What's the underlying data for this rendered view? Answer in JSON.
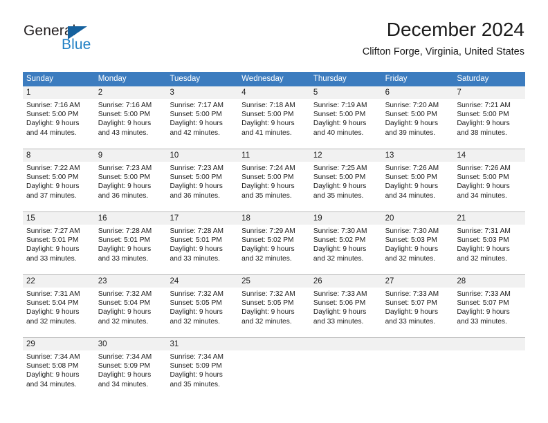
{
  "brand": {
    "name_part1": "General",
    "name_part2": "Blue",
    "triangle_icon": "triangle-icon",
    "blue": "#1f7fc4",
    "dark_blue": "#15619e"
  },
  "header": {
    "title": "December 2024",
    "subtitle": "Clifton Forge, Virginia, United States"
  },
  "calendar": {
    "header_color": "#3c7cbf",
    "daynum_band_color": "#f1f1f1",
    "weekdays": [
      "Sunday",
      "Monday",
      "Tuesday",
      "Wednesday",
      "Thursday",
      "Friday",
      "Saturday"
    ],
    "weeks": [
      {
        "days": [
          {
            "num": "1",
            "lines": [
              "Sunrise: 7:16 AM",
              "Sunset: 5:00 PM",
              "Daylight: 9 hours",
              "and 44 minutes."
            ]
          },
          {
            "num": "2",
            "lines": [
              "Sunrise: 7:16 AM",
              "Sunset: 5:00 PM",
              "Daylight: 9 hours",
              "and 43 minutes."
            ]
          },
          {
            "num": "3",
            "lines": [
              "Sunrise: 7:17 AM",
              "Sunset: 5:00 PM",
              "Daylight: 9 hours",
              "and 42 minutes."
            ]
          },
          {
            "num": "4",
            "lines": [
              "Sunrise: 7:18 AM",
              "Sunset: 5:00 PM",
              "Daylight: 9 hours",
              "and 41 minutes."
            ]
          },
          {
            "num": "5",
            "lines": [
              "Sunrise: 7:19 AM",
              "Sunset: 5:00 PM",
              "Daylight: 9 hours",
              "and 40 minutes."
            ]
          },
          {
            "num": "6",
            "lines": [
              "Sunrise: 7:20 AM",
              "Sunset: 5:00 PM",
              "Daylight: 9 hours",
              "and 39 minutes."
            ]
          },
          {
            "num": "7",
            "lines": [
              "Sunrise: 7:21 AM",
              "Sunset: 5:00 PM",
              "Daylight: 9 hours",
              "and 38 minutes."
            ]
          }
        ]
      },
      {
        "days": [
          {
            "num": "8",
            "lines": [
              "Sunrise: 7:22 AM",
              "Sunset: 5:00 PM",
              "Daylight: 9 hours",
              "and 37 minutes."
            ]
          },
          {
            "num": "9",
            "lines": [
              "Sunrise: 7:23 AM",
              "Sunset: 5:00 PM",
              "Daylight: 9 hours",
              "and 36 minutes."
            ]
          },
          {
            "num": "10",
            "lines": [
              "Sunrise: 7:23 AM",
              "Sunset: 5:00 PM",
              "Daylight: 9 hours",
              "and 36 minutes."
            ]
          },
          {
            "num": "11",
            "lines": [
              "Sunrise: 7:24 AM",
              "Sunset: 5:00 PM",
              "Daylight: 9 hours",
              "and 35 minutes."
            ]
          },
          {
            "num": "12",
            "lines": [
              "Sunrise: 7:25 AM",
              "Sunset: 5:00 PM",
              "Daylight: 9 hours",
              "and 35 minutes."
            ]
          },
          {
            "num": "13",
            "lines": [
              "Sunrise: 7:26 AM",
              "Sunset: 5:00 PM",
              "Daylight: 9 hours",
              "and 34 minutes."
            ]
          },
          {
            "num": "14",
            "lines": [
              "Sunrise: 7:26 AM",
              "Sunset: 5:00 PM",
              "Daylight: 9 hours",
              "and 34 minutes."
            ]
          }
        ]
      },
      {
        "days": [
          {
            "num": "15",
            "lines": [
              "Sunrise: 7:27 AM",
              "Sunset: 5:01 PM",
              "Daylight: 9 hours",
              "and 33 minutes."
            ]
          },
          {
            "num": "16",
            "lines": [
              "Sunrise: 7:28 AM",
              "Sunset: 5:01 PM",
              "Daylight: 9 hours",
              "and 33 minutes."
            ]
          },
          {
            "num": "17",
            "lines": [
              "Sunrise: 7:28 AM",
              "Sunset: 5:01 PM",
              "Daylight: 9 hours",
              "and 33 minutes."
            ]
          },
          {
            "num": "18",
            "lines": [
              "Sunrise: 7:29 AM",
              "Sunset: 5:02 PM",
              "Daylight: 9 hours",
              "and 32 minutes."
            ]
          },
          {
            "num": "19",
            "lines": [
              "Sunrise: 7:30 AM",
              "Sunset: 5:02 PM",
              "Daylight: 9 hours",
              "and 32 minutes."
            ]
          },
          {
            "num": "20",
            "lines": [
              "Sunrise: 7:30 AM",
              "Sunset: 5:03 PM",
              "Daylight: 9 hours",
              "and 32 minutes."
            ]
          },
          {
            "num": "21",
            "lines": [
              "Sunrise: 7:31 AM",
              "Sunset: 5:03 PM",
              "Daylight: 9 hours",
              "and 32 minutes."
            ]
          }
        ]
      },
      {
        "days": [
          {
            "num": "22",
            "lines": [
              "Sunrise: 7:31 AM",
              "Sunset: 5:04 PM",
              "Daylight: 9 hours",
              "and 32 minutes."
            ]
          },
          {
            "num": "23",
            "lines": [
              "Sunrise: 7:32 AM",
              "Sunset: 5:04 PM",
              "Daylight: 9 hours",
              "and 32 minutes."
            ]
          },
          {
            "num": "24",
            "lines": [
              "Sunrise: 7:32 AM",
              "Sunset: 5:05 PM",
              "Daylight: 9 hours",
              "and 32 minutes."
            ]
          },
          {
            "num": "25",
            "lines": [
              "Sunrise: 7:32 AM",
              "Sunset: 5:05 PM",
              "Daylight: 9 hours",
              "and 32 minutes."
            ]
          },
          {
            "num": "26",
            "lines": [
              "Sunrise: 7:33 AM",
              "Sunset: 5:06 PM",
              "Daylight: 9 hours",
              "and 33 minutes."
            ]
          },
          {
            "num": "27",
            "lines": [
              "Sunrise: 7:33 AM",
              "Sunset: 5:07 PM",
              "Daylight: 9 hours",
              "and 33 minutes."
            ]
          },
          {
            "num": "28",
            "lines": [
              "Sunrise: 7:33 AM",
              "Sunset: 5:07 PM",
              "Daylight: 9 hours",
              "and 33 minutes."
            ]
          }
        ]
      },
      {
        "days": [
          {
            "num": "29",
            "lines": [
              "Sunrise: 7:34 AM",
              "Sunset: 5:08 PM",
              "Daylight: 9 hours",
              "and 34 minutes."
            ]
          },
          {
            "num": "30",
            "lines": [
              "Sunrise: 7:34 AM",
              "Sunset: 5:09 PM",
              "Daylight: 9 hours",
              "and 34 minutes."
            ]
          },
          {
            "num": "31",
            "lines": [
              "Sunrise: 7:34 AM",
              "Sunset: 5:09 PM",
              "Daylight: 9 hours",
              "and 35 minutes."
            ]
          },
          {
            "num": "",
            "lines": []
          },
          {
            "num": "",
            "lines": []
          },
          {
            "num": "",
            "lines": []
          },
          {
            "num": "",
            "lines": []
          }
        ]
      }
    ]
  }
}
